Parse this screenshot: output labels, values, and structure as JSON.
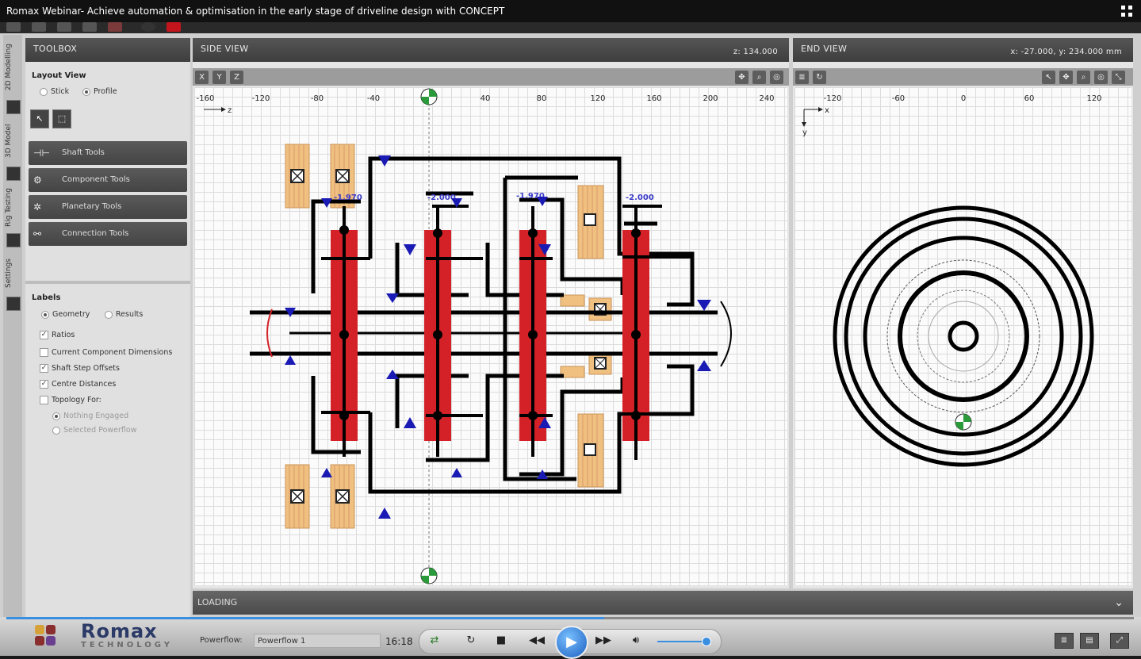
{
  "window": {
    "title": "Romax Webinar- Achieve automation & optimisation in the early stage of driveline design with CONCEPT"
  },
  "side_tabs": [
    "2D Modelling",
    "3D Model",
    "Rig Testing",
    "Settings"
  ],
  "toolbox": {
    "title": "TOOLBOX",
    "layout_view": {
      "heading": "Layout View",
      "options": [
        "Stick",
        "Profile"
      ],
      "selected": "Profile"
    },
    "tools": [
      "Shaft Tools",
      "Component Tools",
      "Planetary Tools",
      "Connection Tools"
    ],
    "labels": {
      "heading": "Labels",
      "mode_options": [
        "Geometry",
        "Results"
      ],
      "mode_selected": "Geometry",
      "checkboxes": [
        {
          "label": "Ratios",
          "checked": true
        },
        {
          "label": "Current Component Dimensions",
          "checked": false
        },
        {
          "label": "Shaft Step Offsets",
          "checked": true
        },
        {
          "label": "Centre Distances",
          "checked": true
        },
        {
          "label": "Topology For:",
          "checked": false
        }
      ],
      "topology_options": [
        "Nothing Engaged",
        "Selected Powerflow"
      ]
    }
  },
  "side_view": {
    "title": "SIDE VIEW",
    "coord": "z: 134.000",
    "toolbar_buttons": [
      "X",
      "Y",
      "Z"
    ],
    "axis_ticks": [
      "-160",
      "-120",
      "-80",
      "-40",
      "40",
      "80",
      "120",
      "160",
      "200",
      "240"
    ],
    "axis_label": "z",
    "gear_labels": [
      "-1.970",
      "-2.000",
      "-1.970",
      "-2.000"
    ]
  },
  "end_view": {
    "title": "END VIEW",
    "coord": "x: -27.000, y: 234.000 mm",
    "axis_ticks": [
      "-120",
      "-60",
      "0",
      "60",
      "120"
    ],
    "axis_labels": [
      "x",
      "y"
    ]
  },
  "loading": {
    "title": "LOADING"
  },
  "footer": {
    "brand": "Romax",
    "brand_sub": "TECHNOLOGY",
    "powerflow_label": "Powerflow:",
    "powerflow_value": "Powerflow 1"
  },
  "player": {
    "time": "16:18",
    "progress": 0.53,
    "volume": 0.9
  },
  "colors": {
    "gear": "#d32127",
    "bearing": "#f0c080",
    "shaft": "#000000",
    "marker": "#1a1ab4",
    "accent": "#3a8fe0"
  }
}
